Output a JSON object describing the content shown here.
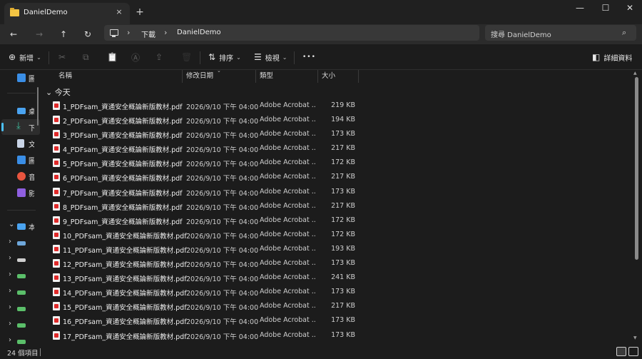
{
  "window": {
    "tab_title": "DanielDemo",
    "tab_close_icon": "×",
    "new_tab_icon": "+",
    "minimize_icon": "—",
    "maximize_icon": "☐",
    "close_icon": "✕"
  },
  "nav": {
    "back_icon": "←",
    "forward_icon": "→",
    "up_icon": "↑",
    "refresh_icon": "↻",
    "breadcrumbs": [
      "下載",
      "DanielDemo"
    ],
    "breadcrumb_sep": "›",
    "search_placeholder": "搜尋 DanielDemo",
    "search_icon": "⌕"
  },
  "commandbar": {
    "new_label": "新增",
    "new_icon": "⊕",
    "cut_icon": "✂",
    "copy_icon": "⧉",
    "paste_icon": "📋",
    "rename_icon": "Ⓐ",
    "share_icon": "⇪",
    "delete_icon": "🗑",
    "sort_label": "排序",
    "sort_icon": "⇅",
    "view_label": "檢視",
    "view_icon": "☰",
    "more_icon": "•••",
    "details_label": "詳細資料",
    "details_icon": "◧",
    "dropdown_icon": "⌄"
  },
  "columns": {
    "name": "名稱",
    "date": "修改日期",
    "type": "類型",
    "size": "大小",
    "sort_indicator": "⌄"
  },
  "group": {
    "chevron": "⌄",
    "label": "今天"
  },
  "files": [
    {
      "name": "1_PDFsam_資通安全概論新版教材.pdf",
      "date": "2026/9/10 下午 04:00",
      "type": "Adobe Acrobat ...",
      "size": "219 KB"
    },
    {
      "name": "2_PDFsam_資通安全概論新版教材.pdf",
      "date": "2026/9/10 下午 04:00",
      "type": "Adobe Acrobat ...",
      "size": "194 KB"
    },
    {
      "name": "3_PDFsam_資通安全概論新版教材.pdf",
      "date": "2026/9/10 下午 04:00",
      "type": "Adobe Acrobat ...",
      "size": "173 KB"
    },
    {
      "name": "4_PDFsam_資通安全概論新版教材.pdf",
      "date": "2026/9/10 下午 04:00",
      "type": "Adobe Acrobat ...",
      "size": "217 KB"
    },
    {
      "name": "5_PDFsam_資通安全概論新版教材.pdf",
      "date": "2026/9/10 下午 04:00",
      "type": "Adobe Acrobat ...",
      "size": "172 KB"
    },
    {
      "name": "6_PDFsam_資通安全概論新版教材.pdf",
      "date": "2026/9/10 下午 04:00",
      "type": "Adobe Acrobat ...",
      "size": "217 KB"
    },
    {
      "name": "7_PDFsam_資通安全概論新版教材.pdf",
      "date": "2026/9/10 下午 04:00",
      "type": "Adobe Acrobat ...",
      "size": "173 KB"
    },
    {
      "name": "8_PDFsam_資通安全概論新版教材.pdf",
      "date": "2026/9/10 下午 04:00",
      "type": "Adobe Acrobat ...",
      "size": "217 KB"
    },
    {
      "name": "9_PDFsam_資通安全概論新版教材.pdf",
      "date": "2026/9/10 下午 04:00",
      "type": "Adobe Acrobat ...",
      "size": "172 KB"
    },
    {
      "name": "10_PDFsam_資通安全概論新版教材.pdf",
      "date": "2026/9/10 下午 04:00",
      "type": "Adobe Acrobat ...",
      "size": "172 KB"
    },
    {
      "name": "11_PDFsam_資通安全概論新版教材.pdf",
      "date": "2026/9/10 下午 04:00",
      "type": "Adobe Acrobat ...",
      "size": "193 KB"
    },
    {
      "name": "12_PDFsam_資通安全概論新版教材.pdf",
      "date": "2026/9/10 下午 04:00",
      "type": "Adobe Acrobat ...",
      "size": "173 KB"
    },
    {
      "name": "13_PDFsam_資通安全概論新版教材.pdf",
      "date": "2026/9/10 下午 04:00",
      "type": "Adobe Acrobat ...",
      "size": "241 KB"
    },
    {
      "name": "14_PDFsam_資通安全概論新版教材.pdf",
      "date": "2026/9/10 下午 04:00",
      "type": "Adobe Acrobat ...",
      "size": "173 KB"
    },
    {
      "name": "15_PDFsam_資通安全概論新版教材.pdf",
      "date": "2026/9/10 下午 04:00",
      "type": "Adobe Acrobat ...",
      "size": "217 KB"
    },
    {
      "name": "16_PDFsam_資通安全概論新版教材.pdf",
      "date": "2026/9/10 下午 04:00",
      "type": "Adobe Acrobat ...",
      "size": "173 KB"
    },
    {
      "name": "17_PDFsam_資通安全概論新版教材.pdf",
      "date": "2026/9/10 下午 04:00",
      "type": "Adobe Acrobat ...",
      "size": "173 KB"
    }
  ],
  "sidebar": {
    "items": [
      {
        "label": "圖",
        "icon": "pictures-icon",
        "color": "#3a8ee6"
      },
      {
        "label": "桌",
        "icon": "desktop-icon",
        "color": "#4aa3f0"
      },
      {
        "label": "下",
        "icon": "downloads-icon",
        "color": "#3fc0a0"
      },
      {
        "label": "文",
        "icon": "documents-icon",
        "color": "#c9d4e6"
      },
      {
        "label": "圖",
        "icon": "pictures-icon",
        "color": "#3a8ee6"
      },
      {
        "label": "音",
        "icon": "music-icon",
        "color": "#e8553f"
      },
      {
        "label": "影",
        "icon": "videos-icon",
        "color": "#8f5fe0"
      },
      {
        "label": "本",
        "icon": "this-pc-icon",
        "color": "#4aa3f0"
      }
    ],
    "chevron_down": "⌄",
    "chevron_right": "›"
  },
  "status": {
    "item_count": "24 個項目"
  },
  "colors": {
    "accent": "#4cc2ff",
    "pdf_red": "#e02a2a",
    "background": "#1c1c1c"
  }
}
